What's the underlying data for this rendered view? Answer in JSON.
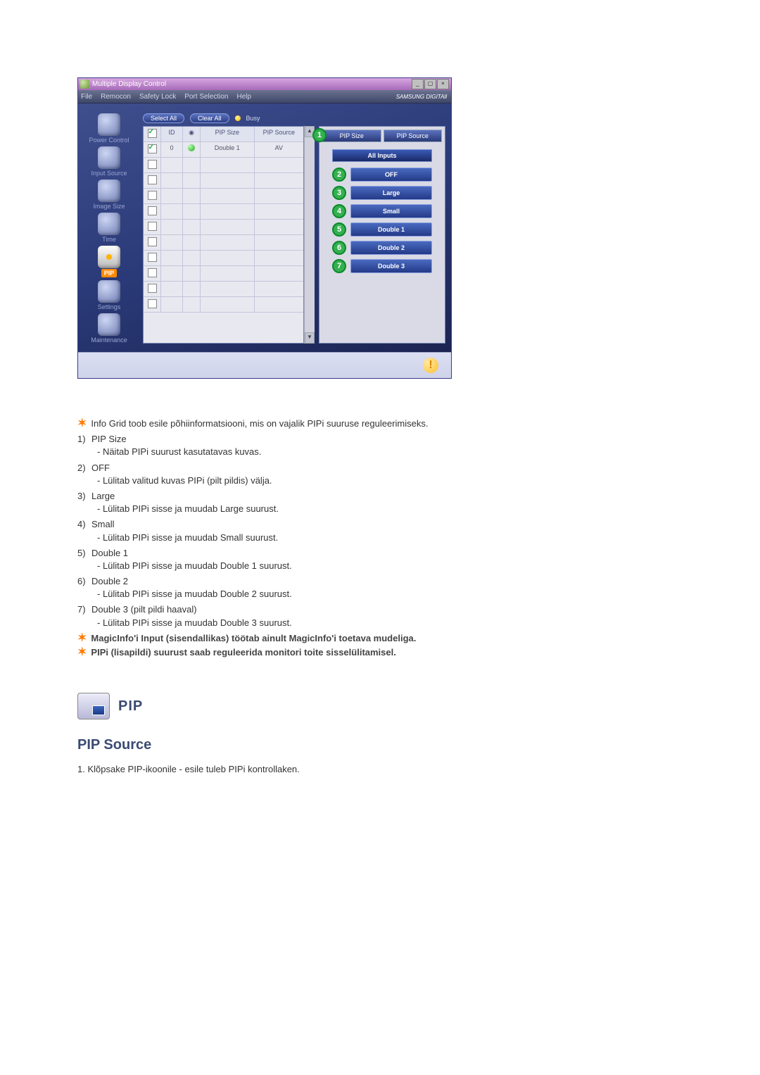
{
  "app": {
    "title": "Multiple Display Control",
    "menu": [
      "File",
      "Remocon",
      "Safety Lock",
      "Port Selection",
      "Help"
    ],
    "brand": "SAMSUNG DIGITAll"
  },
  "sidebar": {
    "items": [
      {
        "label": "Power Control"
      },
      {
        "label": "Input Source"
      },
      {
        "label": "Image Size"
      },
      {
        "label": "Time"
      },
      {
        "label": "PIP"
      },
      {
        "label": "Settings"
      },
      {
        "label": "Maintenance"
      }
    ]
  },
  "toolbar": {
    "select_all": "Select All",
    "clear_all": "Clear All",
    "busy": "Busy"
  },
  "grid": {
    "head": {
      "c2": "ID",
      "c4": "PIP Size",
      "c5": "PIP Source"
    },
    "row": {
      "id": "0",
      "pip_size": "Double 1",
      "pip_source": "AV"
    }
  },
  "right_panel": {
    "tabs": {
      "size": "PIP Size",
      "source": "PIP Source"
    },
    "inputs_title": "All Inputs",
    "buttons": [
      "OFF",
      "Large",
      "Small",
      "Double 1",
      "Double 2",
      "Double 3"
    ]
  },
  "article": {
    "intro": "Info Grid toob esile põhiinformatsiooni, mis on vajalik PIPi suuruse reguleerimiseks.",
    "items": [
      {
        "h": "PIP Size",
        "d": "- Näitab PIPi suurust kasutatavas kuvas."
      },
      {
        "h": "OFF",
        "d": "- Lülitab valitud kuvas PIPi (pilt pildis) välja."
      },
      {
        "h": "Large",
        "d": "- Lülitab PIPi sisse ja muudab Large suurust."
      },
      {
        "h": "Small",
        "d": "- Lülitab PIPi sisse ja muudab Small suurust."
      },
      {
        "h": "Double 1",
        "d": "- Lülitab PIPi sisse ja muudab Double 1 suurust."
      },
      {
        "h": "Double 2",
        "d": "- Lülitab PIPi sisse ja muudab Double 2 suurust."
      },
      {
        "h": "Double 3 (pilt pildi haaval)",
        "d": "- Lülitab PIPi sisse ja muudab Double 3 suurust."
      }
    ],
    "note1": "MagicInfo'i Input (sisendallikas) töötab ainult MagicInfo'i toetava mudeliga.",
    "note2": "PIPi (lisapildi) suurust saab reguleerida monitori toite sisselülitamisel.",
    "pip_heading": "PIP",
    "source_heading": "PIP Source",
    "source_step": "1.  Klõpsake PIP-ikoonile - esile tuleb PIPi kontrollaken."
  },
  "callouts": [
    "1",
    "2",
    "3",
    "4",
    "5",
    "6",
    "7"
  ]
}
